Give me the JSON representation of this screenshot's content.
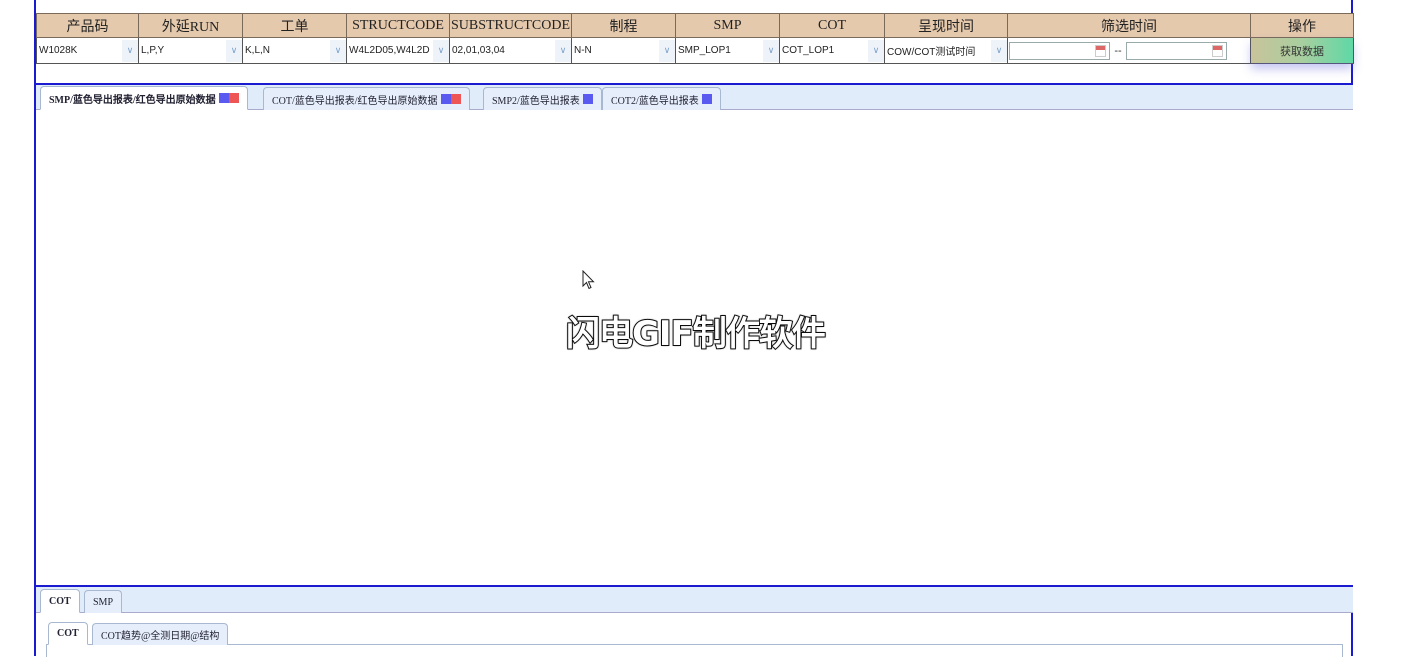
{
  "filters": {
    "headers": [
      "产品码",
      "外延RUN",
      "工单",
      "STRUCTCODE",
      "SUBSTRUCTCODE",
      "制程",
      "SMP",
      "COT",
      "呈现时间",
      "筛选时间",
      "操作"
    ],
    "product_code": "W1028K",
    "epi_run": "L,P,Y",
    "work_order": "K,L,N",
    "structcode": "W4L2D05,W4L2D",
    "substructcode": "02,01,03,04",
    "process": "N-N",
    "smp": "SMP_LOP1",
    "cot": "COT_LOP1",
    "display_time": "COW/COT测试时间",
    "date_start": "",
    "date_end": "",
    "date_separator": "--",
    "fetch_button": "获取数据"
  },
  "main_tabs": [
    {
      "label": "SMP/蓝色导出报表/红色导出原始数据",
      "active": true,
      "swatches": [
        "blue",
        "red"
      ]
    },
    {
      "label": "COT/蓝色导出报表/红色导出原始数据",
      "active": false,
      "swatches": [
        "blue",
        "red"
      ]
    },
    {
      "label": "SMP2/蓝色导出报表",
      "active": false,
      "swatches": [
        "blue"
      ]
    },
    {
      "label": "COT2/蓝色导出报表",
      "active": false,
      "swatches": [
        "blue"
      ]
    }
  ],
  "swatch_colors": {
    "blue": "#5a5af0",
    "red": "#ee5555"
  },
  "watermark": "闪电GIF制作软件",
  "bottom_tabs": [
    {
      "label": "COT",
      "active": true
    },
    {
      "label": "SMP",
      "active": false
    }
  ],
  "bottom_subtabs": [
    {
      "label": "COT",
      "active": true
    },
    {
      "label": "COT趋势@全测日期@结构",
      "active": false
    }
  ]
}
